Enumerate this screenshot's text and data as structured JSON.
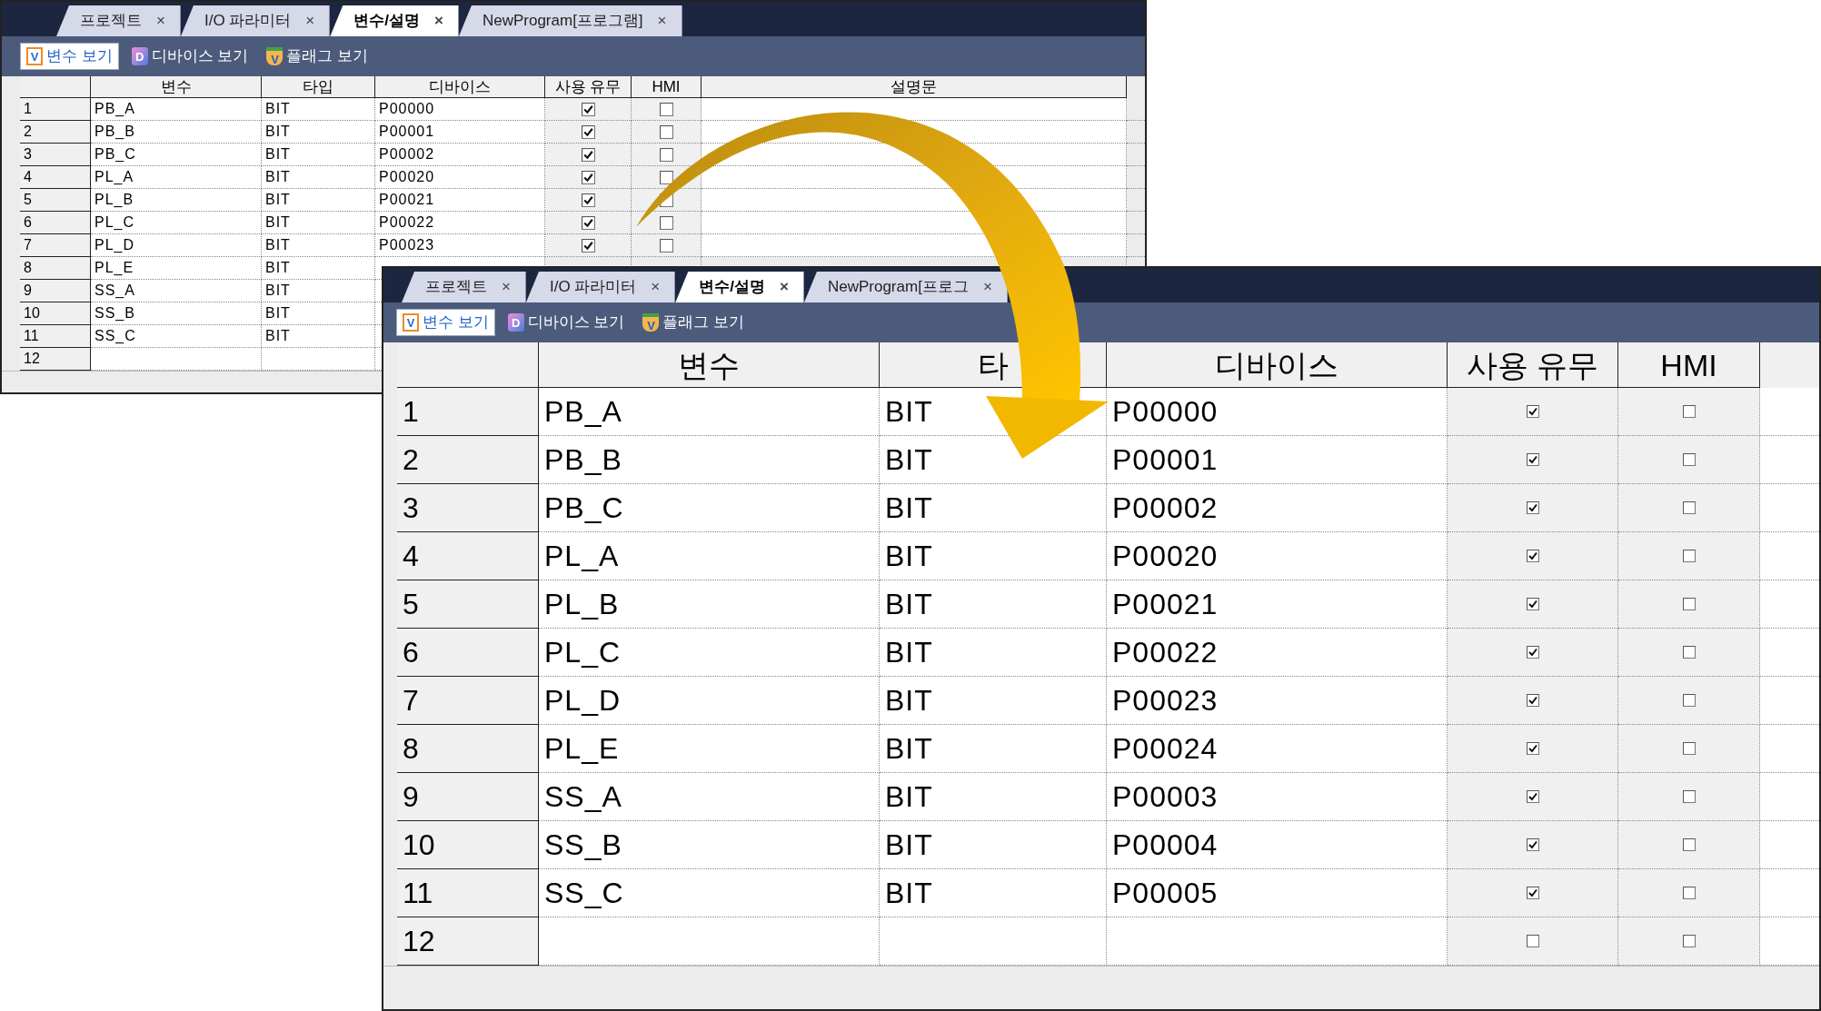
{
  "windows": [
    {
      "tabs": [
        {
          "label": "프로젝트",
          "selected": false
        },
        {
          "label": "I/O 파라미터",
          "selected": false
        },
        {
          "label": "변수/설명",
          "selected": true
        },
        {
          "label": "NewProgram[프로그램]",
          "selected": false
        }
      ],
      "close_glyph": "×",
      "toolbar": [
        {
          "kind": "variable",
          "icon_text": "V",
          "label": "변수 보기",
          "selected": true
        },
        {
          "kind": "device",
          "icon_text": "D",
          "label": "디바이스 보기",
          "selected": false
        },
        {
          "kind": "flag",
          "icon_text": "V",
          "label": "플래그 보기",
          "selected": false
        }
      ],
      "columns": [
        "변수",
        "타입",
        "디바이스",
        "사용 유무",
        "HMI",
        "설명문"
      ],
      "rows": [
        {
          "number": "1",
          "variable": "PB_A",
          "type": "BIT",
          "device": "P00000",
          "used": true,
          "hmi": false
        },
        {
          "number": "2",
          "variable": "PB_B",
          "type": "BIT",
          "device": "P00001",
          "used": true,
          "hmi": false
        },
        {
          "number": "3",
          "variable": "PB_C",
          "type": "BIT",
          "device": "P00002",
          "used": true,
          "hmi": false
        },
        {
          "number": "4",
          "variable": "PL_A",
          "type": "BIT",
          "device": "P00020",
          "used": true,
          "hmi": false
        },
        {
          "number": "5",
          "variable": "PL_B",
          "type": "BIT",
          "device": "P00021",
          "used": true,
          "hmi": false
        },
        {
          "number": "6",
          "variable": "PL_C",
          "type": "BIT",
          "device": "P00022",
          "used": true,
          "hmi": false
        },
        {
          "number": "7",
          "variable": "PL_D",
          "type": "BIT",
          "device": "P00023",
          "used": true,
          "hmi": false
        },
        {
          "number": "8",
          "variable": "PL_E",
          "type": "BIT"
        },
        {
          "number": "9",
          "variable": "SS_A",
          "type": "BIT"
        },
        {
          "number": "10",
          "variable": "SS_B",
          "type": "BIT"
        },
        {
          "number": "11",
          "variable": "SS_C",
          "type": "BIT"
        },
        {
          "number": "12"
        }
      ]
    },
    {
      "tabs": [
        {
          "label": "프로젝트",
          "selected": false
        },
        {
          "label": "I/O 파라미터",
          "selected": false
        },
        {
          "label": "변수/설명",
          "selected": true
        },
        {
          "label": "NewProgram[프로그",
          "selected": false
        }
      ],
      "close_glyph": "×",
      "toolbar": [
        {
          "kind": "variable",
          "icon_text": "V",
          "label": "변수 보기",
          "selected": true
        },
        {
          "kind": "device",
          "icon_text": "D",
          "label": "디바이스 보기",
          "selected": false
        },
        {
          "kind": "flag",
          "icon_text": "V",
          "label": "플래그 보기",
          "selected": false
        }
      ],
      "columns": [
        "변수",
        "타",
        "디바이스",
        "사용 유무",
        "HMI"
      ],
      "rows": [
        {
          "number": "1",
          "variable": "PB_A",
          "type": "BIT",
          "device": "P00000",
          "used": true,
          "hmi": false
        },
        {
          "number": "2",
          "variable": "PB_B",
          "type": "BIT",
          "device": "P00001",
          "used": true,
          "hmi": false
        },
        {
          "number": "3",
          "variable": "PB_C",
          "type": "BIT",
          "device": "P00002",
          "used": true,
          "hmi": false
        },
        {
          "number": "4",
          "variable": "PL_A",
          "type": "BIT",
          "device": "P00020",
          "used": true,
          "hmi": false
        },
        {
          "number": "5",
          "variable": "PL_B",
          "type": "BIT",
          "device": "P00021",
          "used": true,
          "hmi": false
        },
        {
          "number": "6",
          "variable": "PL_C",
          "type": "BIT",
          "device": "P00022",
          "used": true,
          "hmi": false
        },
        {
          "number": "7",
          "variable": "PL_D",
          "type": "BIT",
          "device": "P00023",
          "used": true,
          "hmi": false
        },
        {
          "number": "8",
          "variable": "PL_E",
          "type": "BIT",
          "device": "P00024",
          "used": true,
          "hmi": false
        },
        {
          "number": "9",
          "variable": "SS_A",
          "type": "BIT",
          "device": "P00003",
          "used": true,
          "hmi": false
        },
        {
          "number": "10",
          "variable": "SS_B",
          "type": "BIT",
          "device": "P00004",
          "used": true,
          "hmi": false
        },
        {
          "number": "11",
          "variable": "SS_C",
          "type": "BIT",
          "device": "P00005",
          "used": true,
          "hmi": false
        },
        {
          "number": "12",
          "used": false,
          "hmi": false
        }
      ]
    }
  ]
}
